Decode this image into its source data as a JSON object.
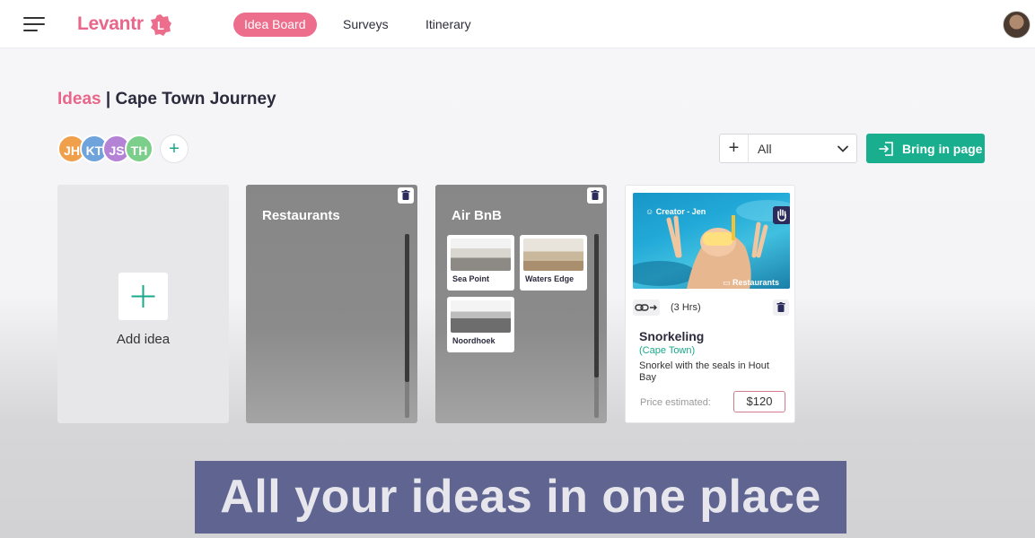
{
  "header": {
    "app_name": "Levantr",
    "logo_badge": "L",
    "nav": [
      {
        "label": "Idea Board",
        "active": true
      },
      {
        "label": "Surveys",
        "active": false
      },
      {
        "label": "Itinerary",
        "active": false
      }
    ],
    "menu_icon": "hamburger-icon",
    "avatar_icon": "user-avatar"
  },
  "page": {
    "title_accent": "Ideas",
    "title_separator": "|",
    "title_main": "Cape Town Journey"
  },
  "collaborators": [
    {
      "initials": "JH",
      "color": "#f0a04b"
    },
    {
      "initials": "KT",
      "color": "#6fa3dc"
    },
    {
      "initials": "JS",
      "color": "#b583d6"
    },
    {
      "initials": "TH",
      "color": "#7ccf8a"
    }
  ],
  "add_collaborator": "+",
  "filter": {
    "plus": "+",
    "value": "All"
  },
  "bring_button": {
    "label": "Bring in page",
    "icon": "import-icon"
  },
  "add_idea": {
    "label": "Add idea",
    "icon": "plus-icon"
  },
  "groups": [
    {
      "title": "Restaurants",
      "items": []
    },
    {
      "title": "Air BnB",
      "items": [
        {
          "label": "Sea Point"
        },
        {
          "label": "Waters Edge"
        },
        {
          "label": "Noordhoek"
        }
      ]
    }
  ],
  "idea_card": {
    "creator": "Creator - Jen",
    "tag": "Restaurants",
    "duration": "(3 Hrs)",
    "name": "Snorkeling",
    "location": "(Cape Town)",
    "description": "Snorkel with the seals in Hout Bay",
    "price_label": "Price estimated:",
    "price": "$120"
  },
  "caption": "All your ideas in one place",
  "colors": {
    "brand_pink": "#e8668a",
    "accent_green": "#19ae8e",
    "caption_bg": "#5f6490"
  }
}
